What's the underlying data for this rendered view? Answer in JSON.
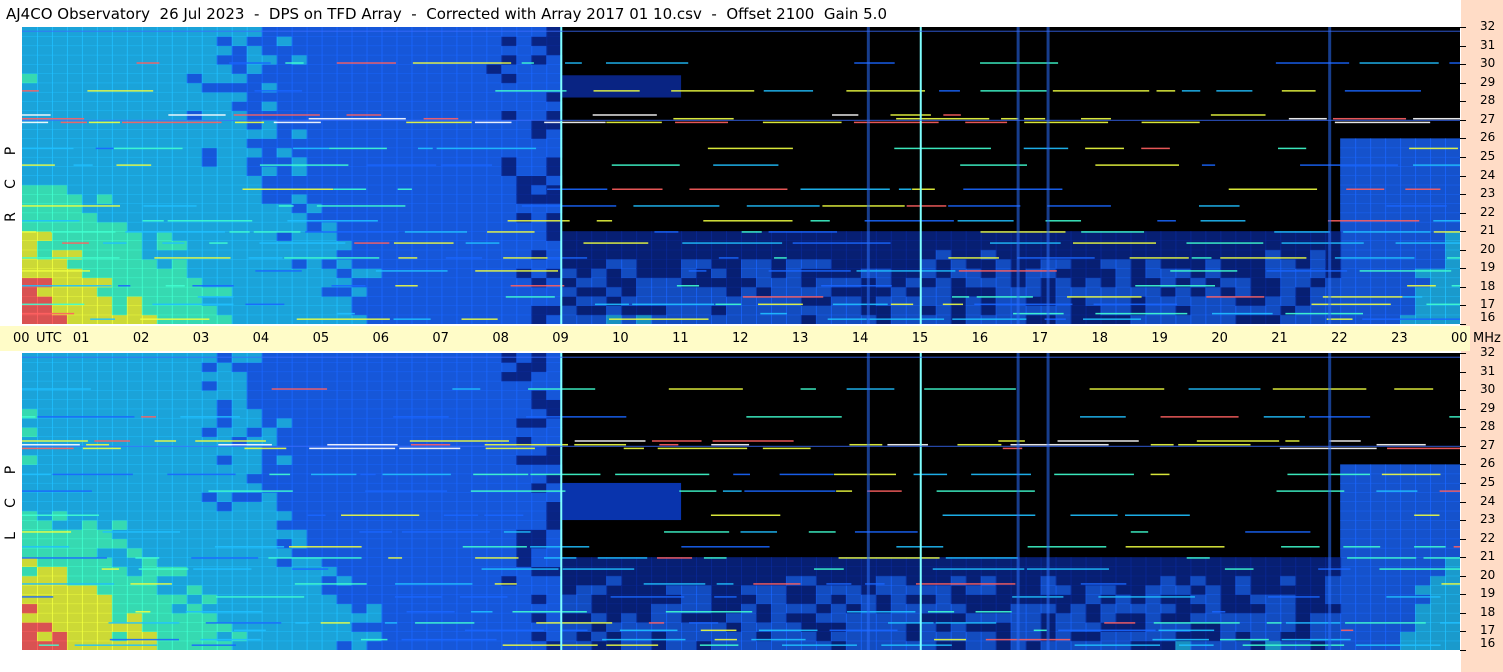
{
  "title": "AJ4CO Observatory  26 Jul 2023  -  DPS on TFD Array  -  Corrected with Array 2017 01 10.csv  -  Offset 2100  Gain 5.0",
  "chart_data": [
    {
      "type": "heatmap",
      "panel": "RCP",
      "side_label_letters": [
        "R",
        "C",
        "P"
      ],
      "x_ticks": [
        "00",
        "UTC",
        "01",
        "02",
        "03",
        "04",
        "05",
        "06",
        "07",
        "08",
        "09",
        "10",
        "11",
        "12",
        "13",
        "14",
        "15",
        "16",
        "17",
        "18",
        "19",
        "20",
        "21",
        "22",
        "23",
        "00",
        "MHz"
      ],
      "x_range_hours": [
        0,
        24
      ],
      "y_ticks": [
        "16",
        "17",
        "18",
        "19",
        "20",
        "21",
        "22",
        "23",
        "24",
        "25",
        "26",
        "27",
        "28",
        "29",
        "30",
        "31",
        "32"
      ],
      "y_range_mhz": [
        16,
        32
      ],
      "vertical_markers_hours": [
        9.0,
        15.0
      ],
      "intense_band_mhz": 27.1
    },
    {
      "type": "heatmap",
      "panel": "LCP",
      "side_label_letters": [
        "L",
        "C",
        "P"
      ],
      "x_range_hours": [
        0,
        24
      ],
      "y_ticks": [
        "16",
        "17",
        "18",
        "19",
        "20",
        "21",
        "22",
        "23",
        "24",
        "25",
        "26",
        "27",
        "28",
        "29",
        "30",
        "31",
        "32"
      ],
      "y_range_mhz": [
        16,
        32
      ],
      "vertical_markers_hours": [
        9.0,
        15.0
      ],
      "intense_band_mhz": 27.1
    }
  ],
  "colors": {
    "background": "#000000",
    "timeaxis_band": "#fffcc8",
    "right_band": "#ffdcc6",
    "marker": "#7fffff"
  }
}
